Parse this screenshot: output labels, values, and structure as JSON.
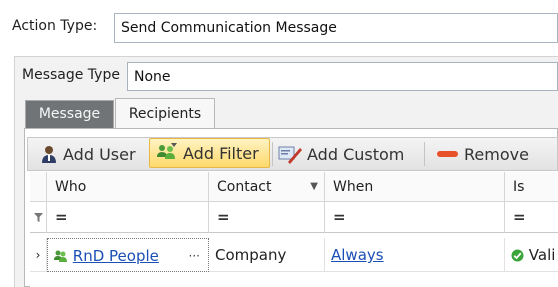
{
  "action_type": {
    "label": "Action Type:",
    "value": "Send Communication Message"
  },
  "message_type": {
    "label": "Message Type",
    "value": "None"
  },
  "tabs": [
    {
      "label": "Message",
      "active": false
    },
    {
      "label": "Recipients",
      "active": true
    }
  ],
  "toolbar": {
    "add_user": "Add User",
    "add_filter": "Add Filter",
    "add_custom": "Add Custom",
    "remove": "Remove"
  },
  "grid": {
    "columns": [
      "Who",
      "Contact",
      "When",
      "Is"
    ],
    "filter_symbol": "=",
    "rows": [
      {
        "who": "RnD People",
        "ellipsis": "···",
        "contact": "Company",
        "when": "Always",
        "is": "Vali"
      }
    ]
  },
  "colors": {
    "highlight": "#ffd96b",
    "link": "#1a4fb5",
    "dark_tab": "#717476",
    "remove_icon": "#e8502a",
    "status_ok": "#3aa53a"
  }
}
